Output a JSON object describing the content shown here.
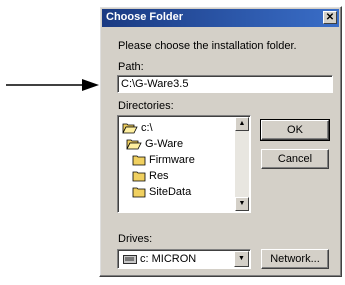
{
  "window": {
    "title": "Choose Folder",
    "close_glyph": "✕"
  },
  "instruction": "Please choose the installation folder.",
  "path": {
    "label": "Path:",
    "value": "C:\\G-Ware3.5"
  },
  "directories": {
    "label": "Directories:",
    "items": [
      {
        "name": "c:\\",
        "icon": "open-folder-icon"
      },
      {
        "name": "G-Ware",
        "icon": "open-folder-icon"
      },
      {
        "name": "Firmware",
        "icon": "folder-icon"
      },
      {
        "name": "Res",
        "icon": "folder-icon"
      },
      {
        "name": "SiteData",
        "icon": "folder-icon"
      }
    ]
  },
  "buttons": {
    "ok": "OK",
    "cancel": "Cancel",
    "network": "Network..."
  },
  "drives": {
    "label": "Drives:",
    "value": "c: MICRON",
    "icon": "drive-icon"
  },
  "colors": {
    "title_bar": "#1a3a82",
    "dialog_face": "#d4d0c8",
    "folder": "#f0d060"
  }
}
